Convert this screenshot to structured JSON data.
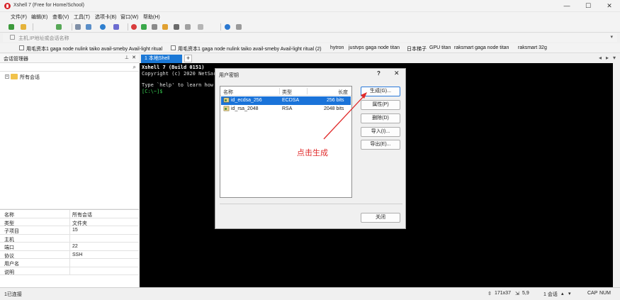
{
  "window": {
    "title": "Xshell 7 (Free for Home/School)",
    "minimize": "—",
    "maximize": "☐",
    "close": "✕"
  },
  "menu": [
    "文件(F)",
    "编辑(E)",
    "查看(V)",
    "工具(T)",
    "选项卡(B)",
    "窗口(W)",
    "帮助(H)"
  ],
  "address_bar": {
    "placeholder": "主机,IP地址或会话名称"
  },
  "quick_bar": [
    "用毛资本1 gaga node nulink taiko avail-smeby Avail-light ritual",
    "用毛资本1 gaga node nulink taiko avail-smeby Avail-light ritual (2)",
    "hytron",
    "justvps gaga node titan",
    "日本梯子",
    "GPU titan",
    "raksmart  gaga node titan",
    "raksmart 32g"
  ],
  "session_manager": {
    "title": "会话管理器",
    "tree_root": "所有会话",
    "properties": [
      {
        "key": "名称",
        "value": "所有会话"
      },
      {
        "key": "类型",
        "value": "文件夹"
      },
      {
        "key": "子项目",
        "value": "15"
      },
      {
        "key": "主机",
        "value": ""
      },
      {
        "key": "端口",
        "value": "22"
      },
      {
        "key": "协议",
        "value": "SSH"
      },
      {
        "key": "用户名",
        "value": ""
      },
      {
        "key": "说明",
        "value": ""
      }
    ]
  },
  "tabs": {
    "active": "1 本地Shell"
  },
  "terminal": {
    "line1": "Xshell 7 (Build 0151)",
    "line2": "Copyright (c) 2020 NetSarang",
    "line3": "Type `help' to learn how to",
    "prompt": "[C:\\~]$ "
  },
  "dialog": {
    "title": "用户密钥",
    "help": "?",
    "close": "✕",
    "columns": [
      "名称",
      "类型",
      "长度"
    ],
    "keys": [
      {
        "name": "id_ecdsa_256",
        "type": "ECDSA",
        "length": "256 bits",
        "selected": true
      },
      {
        "name": "id_rsa_2048",
        "type": "RSA",
        "length": "2048 bits",
        "selected": false
      }
    ],
    "buttons": {
      "generate": "生成(G)...",
      "properties": "属性(P)",
      "delete": "删除(D)",
      "import": "导入(I)...",
      "export": "导出(E)...",
      "close": "关闭"
    }
  },
  "annotation": {
    "text": "点击生成",
    "color": "#e02b2b"
  },
  "status_bar": {
    "left": "1已连接",
    "size": "171x37",
    "pos": "5,9",
    "sessions": "1 会话",
    "cap": "CAP",
    "num": "NUM"
  },
  "colors": {
    "accent": "#1b78d6",
    "terminal_bg": "#000000",
    "selection": "#1a73d9"
  }
}
